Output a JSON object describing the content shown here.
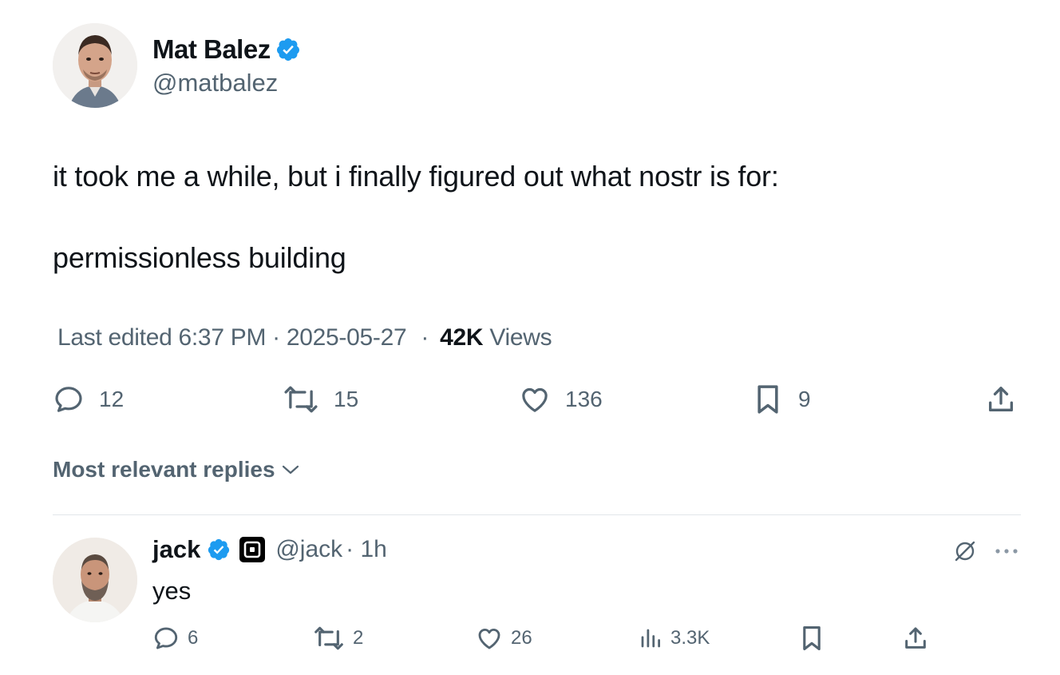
{
  "tweet": {
    "author": {
      "name": "Mat Balez",
      "handle": "@matbalez"
    },
    "text_lines": [
      "it took me a while, but i finally figured out what nostr is for:",
      "permissionless building"
    ],
    "meta": {
      "edited_prefix": "Last edited 6:37 PM · 2025-05-27",
      "separator": "·",
      "views_count": "42K",
      "views_label": "Views"
    },
    "actions": {
      "replies": "12",
      "reposts": "15",
      "likes": "136",
      "bookmarks": "9"
    }
  },
  "replies_filter": {
    "label": "Most relevant replies"
  },
  "reply": {
    "author": {
      "name": "jack",
      "handle": "@jack",
      "time": "· 1h"
    },
    "text": "yes",
    "actions": {
      "replies": "6",
      "reposts": "2",
      "likes": "26",
      "views": "3.3K"
    }
  },
  "colors": {
    "text": "#0f1419",
    "secondary": "#536471",
    "verified": "#1d9bf0",
    "divider": "#e1e6ea"
  },
  "icons": {
    "verified": "verified-badge-icon",
    "reply": "speech-bubble-icon",
    "repost": "repost-arrows-icon",
    "like": "heart-icon",
    "bookmark": "bookmark-icon",
    "share": "share-upload-icon",
    "views": "bar-chart-icon",
    "chevron": "chevron-down-icon",
    "grok": "slashed-circle-icon",
    "more": "more-dots-icon",
    "affiliate": "square-company-badge-icon"
  }
}
